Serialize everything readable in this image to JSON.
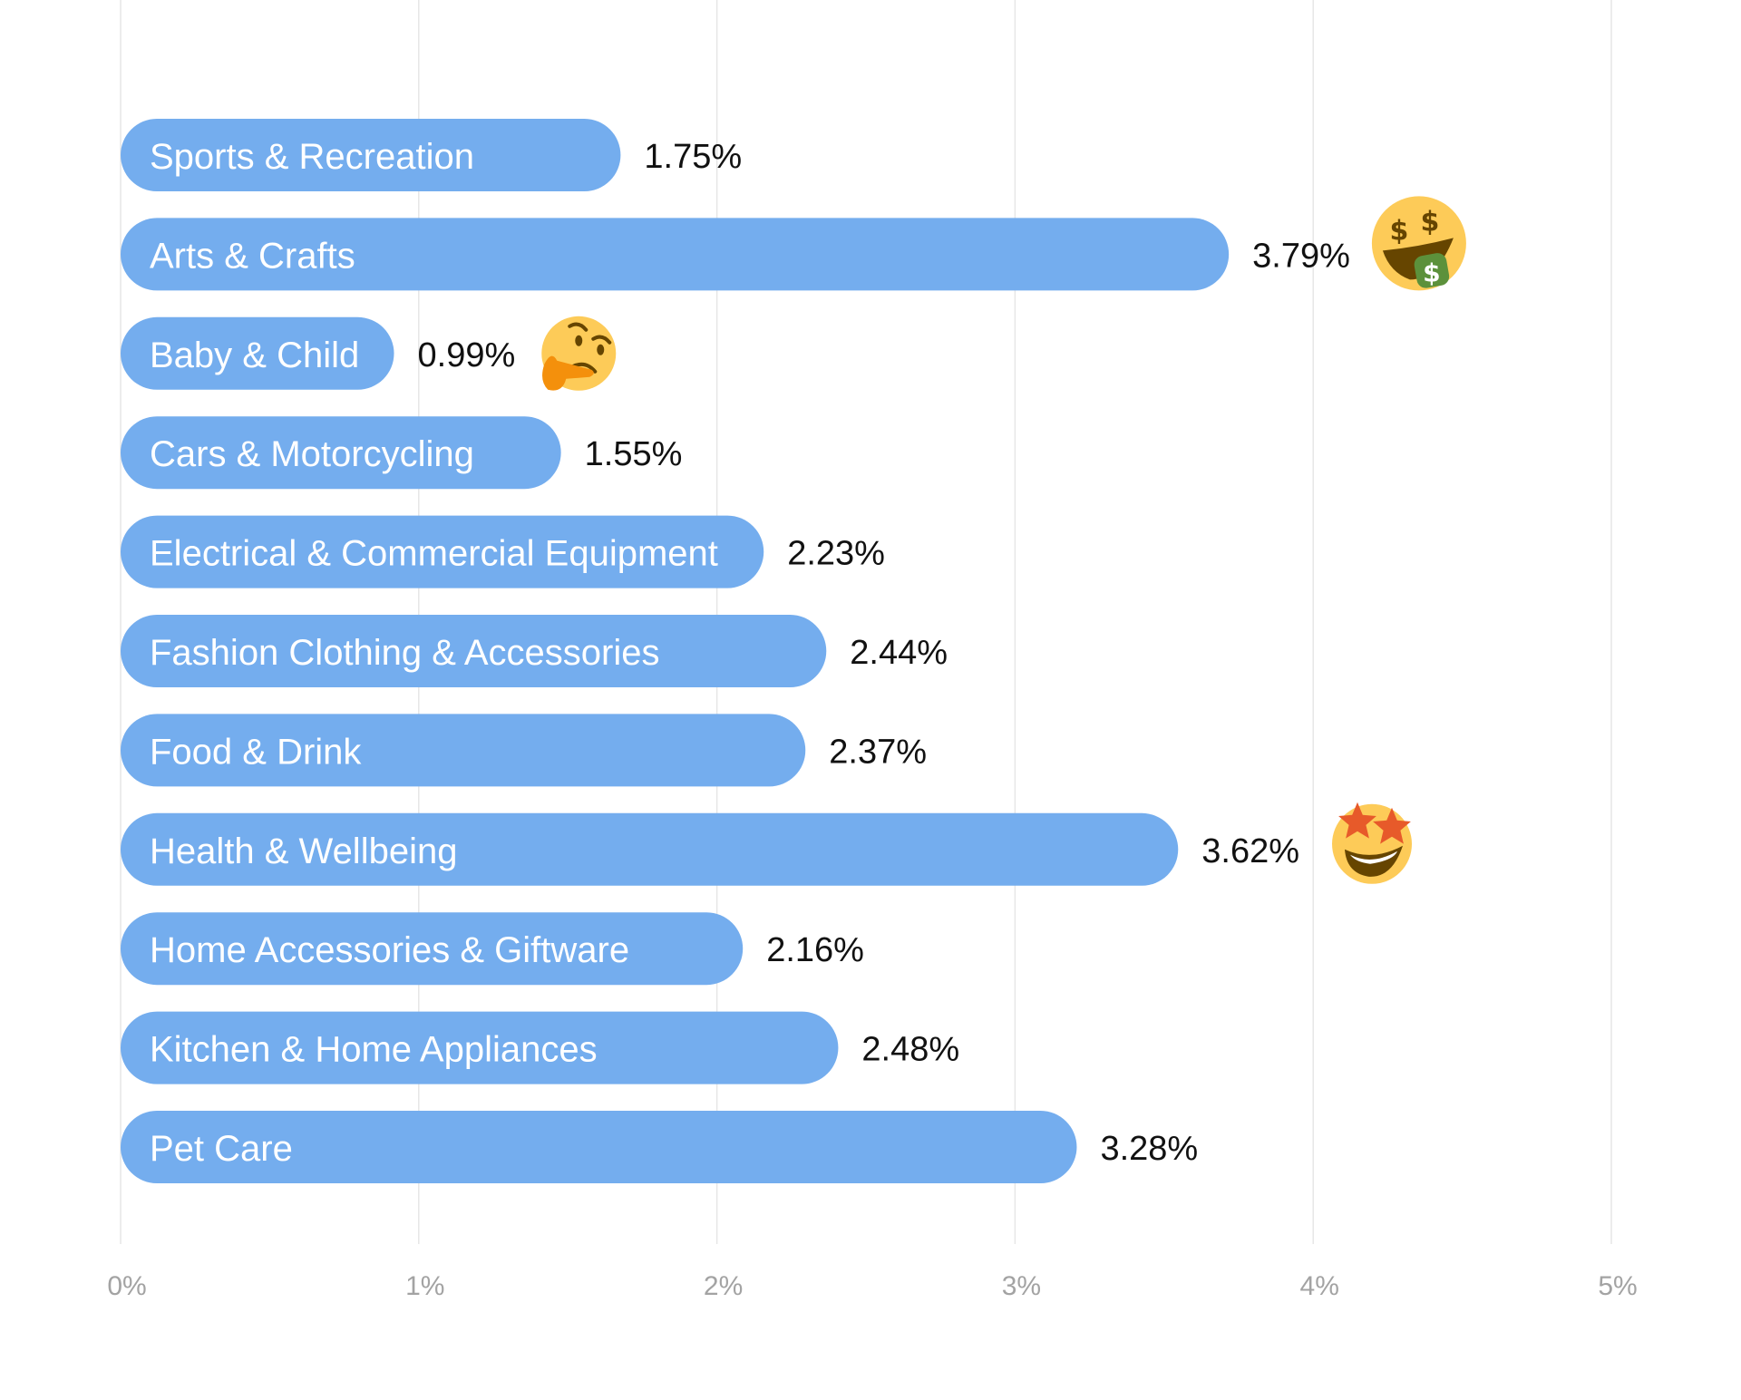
{
  "chart_data": {
    "type": "bar",
    "orientation": "horizontal",
    "title": "",
    "xlabel": "",
    "ylabel": "",
    "xlim": [
      0,
      5
    ],
    "grid": true,
    "legend": "none",
    "x_ticks": [
      0,
      1,
      2,
      3,
      4,
      5
    ],
    "x_tick_labels": [
      "0%",
      "1%",
      "2%",
      "3%",
      "4%",
      "5%"
    ],
    "categories": [
      "Sports & Recreation",
      "Arts & Crafts",
      "Baby & Child",
      "Cars & Motorcycling",
      "Electrical & Commercial Equipment",
      "Fashion Clothing & Accessories",
      "Food & Drink",
      "Health & Wellbeing",
      "Home Accessories & Giftware",
      "Kitchen & Home Appliances",
      "Pet Care"
    ],
    "values": [
      1.75,
      3.79,
      0.99,
      1.55,
      2.23,
      2.44,
      2.37,
      3.62,
      2.16,
      2.48,
      3.28
    ],
    "value_labels": [
      "1.75%",
      "3.79%",
      "0.99%",
      "1.55%",
      "2.23%",
      "2.44%",
      "2.37%",
      "3.62%",
      "2.16%",
      "2.48%",
      "3.28%"
    ],
    "annotations": [
      {
        "category": "Arts & Crafts",
        "emoji": "money-mouth-face"
      },
      {
        "category": "Baby & Child",
        "emoji": "thinking-face"
      },
      {
        "category": "Health & Wellbeing",
        "emoji": "star-struck-face"
      }
    ],
    "colors": {
      "bar": "#74adee",
      "bar_text": "#ffffff",
      "value_text": "#111111",
      "tick_text": "#a3a3a3",
      "grid": "#e6e6e6"
    }
  }
}
